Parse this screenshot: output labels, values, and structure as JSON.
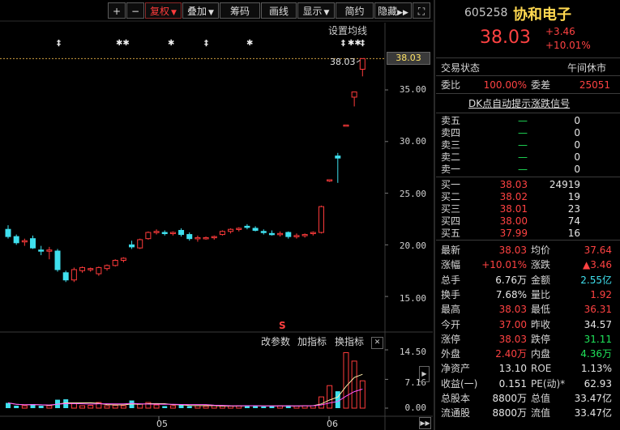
{
  "toolbar": {
    "zoom_in": "+",
    "zoom_out": "−",
    "restore_right": "复权",
    "overlay": "叠加",
    "chips": "筹码",
    "drawline": "画线",
    "display": "显示",
    "simple": "简约",
    "hide": "隐藏",
    "expand_icon": "⛶"
  },
  "chart_header": {
    "set_ma": "设置均线",
    "markers": [
      "‡",
      "✱✱",
      "✱",
      "‡",
      "✱",
      "‡",
      "✱✱",
      "‡"
    ],
    "price_label": "38.03",
    "current_price_box": "38.03",
    "s_marker": "S"
  },
  "price_axis": [
    "35.00",
    "30.00",
    "25.00",
    "20.00",
    "15.00"
  ],
  "volume_panel": {
    "change_params": "改参数",
    "add_indicator": "加指标",
    "swap_indicator": "换指标",
    "close": "✕",
    "axis": [
      "14.50",
      "7.16",
      "0.00"
    ]
  },
  "x_axis": [
    "05",
    "06"
  ],
  "stock": {
    "code": "605258",
    "name": "协和电子",
    "price": "38.03",
    "change": "+3.46",
    "change_pct": "+10.01%"
  },
  "status": {
    "label": "交易状态",
    "value": "午间休市"
  },
  "ratio": {
    "wb_label": "委比",
    "wb_value": "100.00%",
    "wc_label": "委差",
    "wc_value": "25051"
  },
  "signal_link": "DK点自动提示涨跌信号",
  "sell_orders": [
    {
      "label": "卖五",
      "price": "—",
      "vol": "0"
    },
    {
      "label": "卖四",
      "price": "—",
      "vol": "0"
    },
    {
      "label": "卖三",
      "price": "—",
      "vol": "0"
    },
    {
      "label": "卖二",
      "price": "—",
      "vol": "0"
    },
    {
      "label": "卖一",
      "price": "—",
      "vol": "0"
    }
  ],
  "buy_orders": [
    {
      "label": "买一",
      "price": "38.03",
      "vol": "24919"
    },
    {
      "label": "买二",
      "price": "38.02",
      "vol": "19"
    },
    {
      "label": "买三",
      "price": "38.01",
      "vol": "23"
    },
    {
      "label": "买四",
      "price": "38.00",
      "vol": "74"
    },
    {
      "label": "买五",
      "price": "37.99",
      "vol": "16"
    }
  ],
  "quote": [
    {
      "l1": "最新",
      "v1": "38.03",
      "c1": "red",
      "l2": "均价",
      "v2": "37.64",
      "c2": "red"
    },
    {
      "l1": "涨幅",
      "v1": "+10.01%",
      "c1": "red",
      "l2": "涨跌",
      "v2": "▲3.46",
      "c2": "red"
    },
    {
      "l1": "总手",
      "v1": "6.76万",
      "c1": "white",
      "l2": "金额",
      "v2": "2.55亿",
      "c2": "cyan"
    },
    {
      "l1": "换手",
      "v1": "7.68%",
      "c1": "white",
      "l2": "量比",
      "v2": "1.92",
      "c2": "red"
    },
    {
      "l1": "最高",
      "v1": "38.03",
      "c1": "red",
      "l2": "最低",
      "v2": "36.31",
      "c2": "red"
    },
    {
      "l1": "今开",
      "v1": "37.00",
      "c1": "red",
      "l2": "昨收",
      "v2": "34.57",
      "c2": "white"
    },
    {
      "l1": "涨停",
      "v1": "38.03",
      "c1": "red",
      "l2": "跌停",
      "v2": "31.11",
      "c2": "green"
    },
    {
      "l1": "外盘",
      "v1": "2.40万",
      "c1": "red",
      "l2": "内盘",
      "v2": "4.36万",
      "c2": "green"
    },
    {
      "l1": "净资产",
      "v1": "13.10",
      "c1": "white",
      "l2": "ROE",
      "v2": "1.13%",
      "c2": "white"
    },
    {
      "l1": "收益(一)",
      "v1": "0.151",
      "c1": "white",
      "l2": "PE(动)*",
      "v2": "62.93",
      "c2": "white"
    },
    {
      "l1": "总股本",
      "v1": "8800万",
      "c1": "white",
      "l2": "总值",
      "v2": "33.47亿",
      "c2": "white"
    },
    {
      "l1": "流通股",
      "v1": "8800万",
      "c1": "white",
      "l2": "流值",
      "v2": "33.47亿",
      "c2": "white"
    }
  ],
  "chart_data": {
    "type": "candlestick",
    "ylim": [
      12.5,
      39
    ],
    "candles": [
      {
        "o": 21.5,
        "h": 21.9,
        "l": 20.6,
        "c": 20.8
      },
      {
        "o": 20.8,
        "h": 21.0,
        "l": 20.0,
        "c": 20.2
      },
      {
        "o": 20.3,
        "h": 20.6,
        "l": 19.9,
        "c": 20.4
      },
      {
        "o": 20.6,
        "h": 20.9,
        "l": 19.6,
        "c": 19.7
      },
      {
        "o": 19.5,
        "h": 19.9,
        "l": 19.0,
        "c": 19.4
      },
      {
        "o": 19.4,
        "h": 19.8,
        "l": 18.6,
        "c": 19.5
      },
      {
        "o": 19.4,
        "h": 19.6,
        "l": 17.4,
        "c": 17.6
      },
      {
        "o": 17.3,
        "h": 17.5,
        "l": 16.4,
        "c": 16.6
      },
      {
        "o": 16.6,
        "h": 17.8,
        "l": 16.4,
        "c": 17.6
      },
      {
        "o": 17.5,
        "h": 17.9,
        "l": 17.3,
        "c": 17.8
      },
      {
        "o": 17.6,
        "h": 17.8,
        "l": 17.4,
        "c": 17.7
      },
      {
        "o": 17.2,
        "h": 17.9,
        "l": 17.0,
        "c": 17.8
      },
      {
        "o": 17.7,
        "h": 18.1,
        "l": 17.5,
        "c": 18.0
      },
      {
        "o": 18.0,
        "h": 18.6,
        "l": 17.9,
        "c": 18.5
      },
      {
        "o": 18.5,
        "h": 18.8,
        "l": 18.3,
        "c": 18.7
      },
      {
        "o": 20.0,
        "h": 20.4,
        "l": 19.6,
        "c": 19.8
      },
      {
        "o": 19.7,
        "h": 20.6,
        "l": 19.6,
        "c": 20.5
      },
      {
        "o": 20.6,
        "h": 21.3,
        "l": 20.5,
        "c": 21.2
      },
      {
        "o": 21.2,
        "h": 21.5,
        "l": 21.0,
        "c": 21.3
      },
      {
        "o": 21.2,
        "h": 21.4,
        "l": 20.9,
        "c": 21.1
      },
      {
        "o": 21.1,
        "h": 21.3,
        "l": 20.9,
        "c": 21.2
      },
      {
        "o": 21.4,
        "h": 21.6,
        "l": 20.8,
        "c": 21.0
      },
      {
        "o": 21.0,
        "h": 21.2,
        "l": 20.4,
        "c": 20.6
      },
      {
        "o": 20.6,
        "h": 20.9,
        "l": 20.3,
        "c": 20.7
      },
      {
        "o": 20.6,
        "h": 20.8,
        "l": 20.5,
        "c": 20.7
      },
      {
        "o": 20.7,
        "h": 20.9,
        "l": 20.5,
        "c": 20.8
      },
      {
        "o": 21.0,
        "h": 21.4,
        "l": 20.9,
        "c": 21.3
      },
      {
        "o": 21.3,
        "h": 21.6,
        "l": 21.1,
        "c": 21.5
      },
      {
        "o": 21.5,
        "h": 21.7,
        "l": 21.3,
        "c": 21.6
      },
      {
        "o": 21.8,
        "h": 22.0,
        "l": 21.5,
        "c": 21.7
      },
      {
        "o": 21.6,
        "h": 21.8,
        "l": 21.3,
        "c": 21.4
      },
      {
        "o": 21.3,
        "h": 21.5,
        "l": 21.0,
        "c": 21.2
      },
      {
        "o": 21.1,
        "h": 21.4,
        "l": 20.9,
        "c": 21.0
      },
      {
        "o": 21.0,
        "h": 21.3,
        "l": 20.8,
        "c": 21.1
      },
      {
        "o": 21.2,
        "h": 21.3,
        "l": 20.6,
        "c": 20.8
      },
      {
        "o": 20.8,
        "h": 21.1,
        "l": 20.6,
        "c": 20.9
      },
      {
        "o": 20.9,
        "h": 21.1,
        "l": 20.7,
        "c": 21.0
      },
      {
        "o": 21.1,
        "h": 21.3,
        "l": 20.9,
        "c": 21.2
      },
      {
        "o": 21.2,
        "h": 23.8,
        "l": 21.1,
        "c": 23.7
      },
      {
        "o": 26.2,
        "h": 26.3,
        "l": 26.1,
        "c": 26.3
      },
      {
        "o": 28.6,
        "h": 28.9,
        "l": 26.0,
        "c": 28.4
      },
      {
        "o": 31.5,
        "h": 31.6,
        "l": 31.5,
        "c": 31.6
      },
      {
        "o": 34.3,
        "h": 34.8,
        "l": 33.4,
        "c": 34.8
      },
      {
        "o": 37.0,
        "h": 38.03,
        "l": 36.31,
        "c": 38.03
      }
    ],
    "volume": [
      1.3,
      0.6,
      0.6,
      1.0,
      0.6,
      0.6,
      2.1,
      2.2,
      1.1,
      0.6,
      0.7,
      1.4,
      0.6,
      0.7,
      0.6,
      1.9,
      1.0,
      1.4,
      0.8,
      0.5,
      0.6,
      0.9,
      0.5,
      0.6,
      0.5,
      0.6,
      0.5,
      0.5,
      0.6,
      0.7,
      0.6,
      0.4,
      0.5,
      0.6,
      0.7,
      0.5,
      0.6,
      0.6,
      2.8,
      5.6,
      4.2,
      13.8,
      11.7,
      6.8
    ],
    "y_axis": [
      "35.00",
      "30.00",
      "25.00",
      "20.00",
      "15.00"
    ],
    "vol_axis": [
      "14.50",
      "7.16",
      "0.00"
    ],
    "vol_ylim": [
      0,
      14.5
    ],
    "x_labels": [
      "05",
      "06"
    ],
    "colors": {
      "up": "#ff3b3b",
      "down": "#3fe0ee",
      "flat": "#ffffff",
      "ma": "#ffeeaa",
      "ma2": "#ff55ff"
    }
  }
}
